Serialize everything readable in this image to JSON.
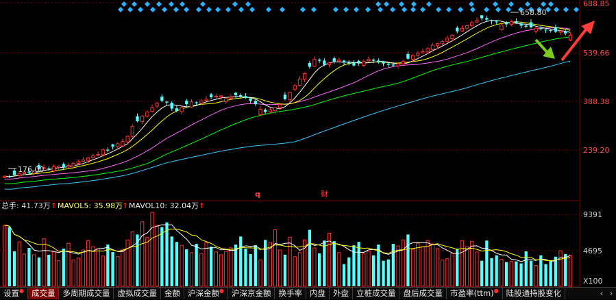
{
  "colors": {
    "up": "#ff3232",
    "down": "#54ffff",
    "ma5": "#ffffff",
    "ma10": "#ffff00",
    "ma20": "#ff66ff",
    "ma30": "#00ff00",
    "ma60": "#33ccff",
    "vol_ma5": "#ffffff",
    "vol_ma10": "#ffff00",
    "grid": "#7a0000",
    "arrow_up": "#ff3c3c",
    "arrow_down": "#7ccc1e"
  },
  "price_axis": {
    "ticks": [
      "688.85",
      "539.66",
      "388.38",
      "239.20"
    ]
  },
  "volume_axis": {
    "ticks": [
      "9391",
      "4695"
    ],
    "unit": "X100"
  },
  "price_markers": {
    "high": "658.80",
    "low": "176.00"
  },
  "event_markers": [
    "q",
    "财"
  ],
  "volume_legend": {
    "total_label": "总手: 41.73万",
    "ma5_label": "MAVOL5: 35.98万",
    "ma10_label": "MAVOL10: 32.04万"
  },
  "tabs": [
    {
      "label": "设置",
      "dot": true
    },
    {
      "label": "成交量",
      "active": true
    },
    {
      "label": "多周期成交量"
    },
    {
      "label": "虚拟成交量"
    },
    {
      "label": "金额"
    },
    {
      "label": "沪深金额",
      "dot": true
    },
    {
      "label": "沪深京金额"
    },
    {
      "label": "换手率"
    },
    {
      "label": "内盘"
    },
    {
      "label": "外盘"
    },
    {
      "label": "立桩成交量"
    },
    {
      "label": "盘后成交量"
    },
    {
      "label": "市盈率(ttm)",
      "dot": true
    },
    {
      "label": "陆股通持股变化"
    }
  ],
  "nav": {
    "prev": "‹",
    "next": "›"
  },
  "chart_data": [
    {
      "type": "candlestick",
      "ylim": [
        160,
        700
      ],
      "close": [
        182,
        180,
        185,
        190,
        194,
        192,
        198,
        203,
        207,
        205,
        210,
        212,
        208,
        214,
        220,
        225,
        230,
        236,
        242,
        246,
        260,
        258,
        270,
        278,
        285,
        300,
        330,
        345,
        360,
        372,
        385,
        398,
        405,
        400,
        382,
        375,
        386,
        395,
        402,
        398,
        405,
        410,
        416,
        419,
        420,
        412,
        416,
        422,
        418,
        414,
        405,
        395,
        380,
        372,
        378,
        385,
        394,
        410,
        430,
        450,
        470,
        486,
        506,
        528,
        524,
        512,
        518,
        522,
        526,
        520,
        516,
        510,
        516,
        522,
        528,
        524,
        520,
        516,
        512,
        510,
        515,
        522,
        530,
        540,
        546,
        551,
        560,
        570,
        575,
        581,
        591,
        600,
        611,
        620,
        628,
        637,
        643,
        650,
        646,
        641,
        638,
        630,
        632,
        640,
        636,
        628,
        625,
        623,
        620,
        618,
        615,
        614,
        610,
        612,
        605,
        600
      ],
      "high_value": 658.8,
      "low_value": 176.0
    },
    {
      "type": "bar",
      "title": "成交量",
      "ylim": [
        0,
        11000
      ],
      "values": [
        9100,
        8800,
        5200,
        6600,
        4800,
        5700,
        4700,
        4300,
        7100,
        4700,
        5100,
        3800,
        5600,
        6400,
        3900,
        4200,
        5400,
        6800,
        5900,
        5600,
        4500,
        6200,
        5100,
        4400,
        5500,
        6900,
        8100,
        7700,
        9600,
        7300,
        11000,
        9100,
        8800,
        9500,
        7400,
        6600,
        6100,
        5500,
        5000,
        6300,
        4900,
        6500,
        5900,
        5100,
        4700,
        5200,
        5700,
        6200,
        7400,
        5600,
        4800,
        6100,
        3900,
        6900,
        6500,
        8400,
        5400,
        4700,
        7300,
        4400,
        5000,
        6900,
        8400,
        5700,
        4900,
        6800,
        7900,
        6700,
        5000,
        3300,
        4300,
        6100,
        6600,
        4900,
        5200,
        4600,
        6200,
        3800,
        4000,
        6300,
        6000,
        6900,
        7700,
        5500,
        6400,
        5900,
        6800,
        6300,
        5600,
        3900,
        4100,
        4900,
        5600,
        6800,
        5900,
        6700,
        5100,
        3800,
        6800,
        4200,
        4600,
        4000,
        3600,
        3700,
        3700,
        3400,
        5200,
        3800,
        3100,
        4600,
        3300,
        3700,
        4400,
        5300,
        4800,
        4600
      ],
      "series": [
        {
          "name": "MAVOL5"
        },
        {
          "name": "MAVOL10"
        }
      ]
    }
  ]
}
